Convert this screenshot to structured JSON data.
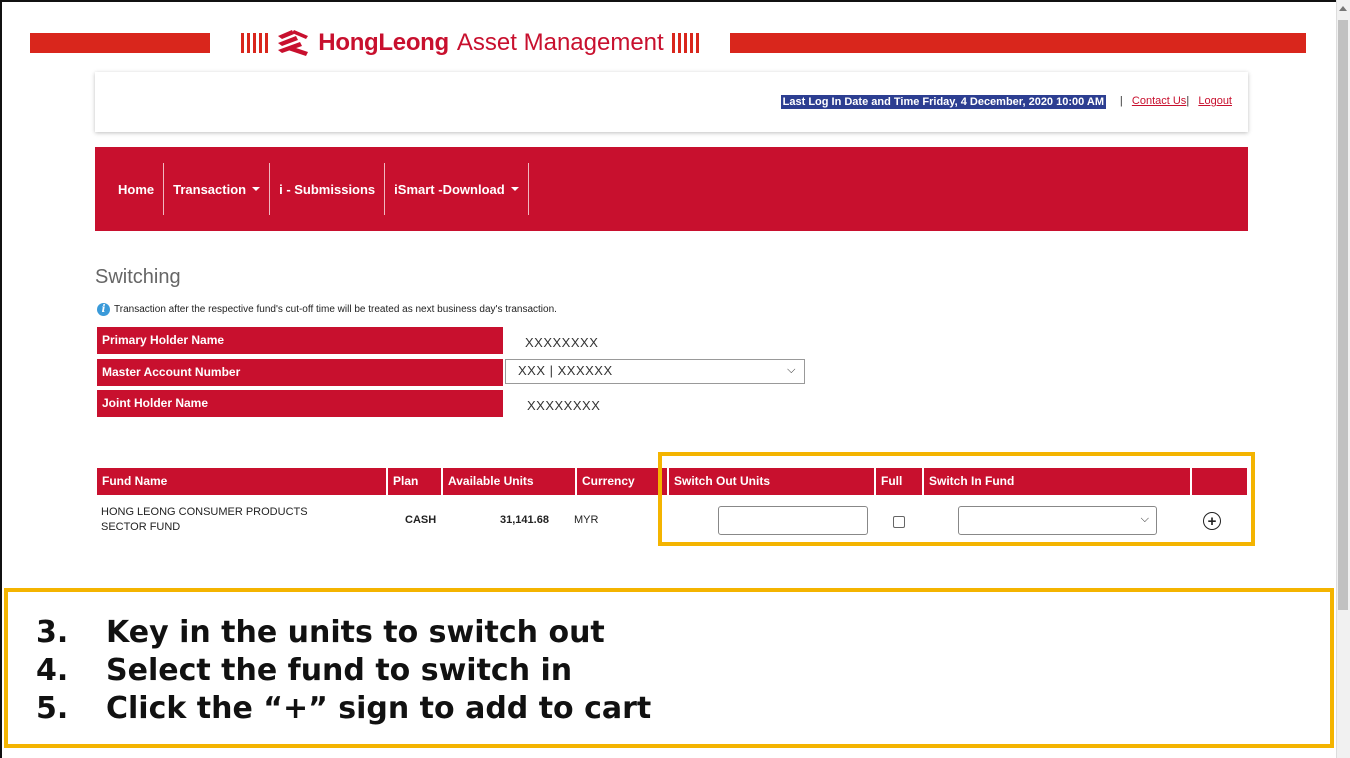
{
  "brand": {
    "name_bold": "HongLeong",
    "name_rest": "Asset Management"
  },
  "header": {
    "last_login": "Last Log In Date and Time Friday, 4 December, 2020 10:00 AM",
    "separator": "|",
    "contact_us": "Contact Us",
    "separator2": "|",
    "logout": "Logout"
  },
  "nav": {
    "items": [
      {
        "label": "Home"
      },
      {
        "label": "Transaction"
      },
      {
        "label": "i - Submissions"
      },
      {
        "label": "iSmart -Download"
      }
    ]
  },
  "page": {
    "title": "Switching",
    "notice": "Transaction after the respective fund's cut-off time will be treated as next business day's transaction."
  },
  "holder": {
    "primary_label": "Primary Holder Name",
    "primary_value": "XXXXXXXX",
    "account_label": "Master Account Number",
    "account_value": "XXX | XXXXXX",
    "joint_label": "Joint Holder Name",
    "joint_value": "XXXXXXXX"
  },
  "fund_table": {
    "headers": [
      "Fund Name",
      "Plan",
      "Available Units",
      "Currency",
      "Switch Out Units",
      "Full",
      "Switch In Fund"
    ],
    "row": {
      "fund_name_line1": "HONG LEONG CONSUMER PRODUCTS",
      "fund_name_line2": "SECTOR FUND",
      "plan": "CASH",
      "available_units": "31,141.68",
      "currency": "MYR",
      "switch_out_units": "",
      "switch_in_fund": ""
    }
  },
  "instructions": [
    {
      "num": "3.",
      "text": "Key in the units to switch out"
    },
    {
      "num": "4.",
      "text": "Select the fund to switch in"
    },
    {
      "num": "5.",
      "text": "Click the “+” sign to add to cart"
    }
  ],
  "colors": {
    "brand_red": "#c8102e",
    "highlight": "#f4b400"
  }
}
